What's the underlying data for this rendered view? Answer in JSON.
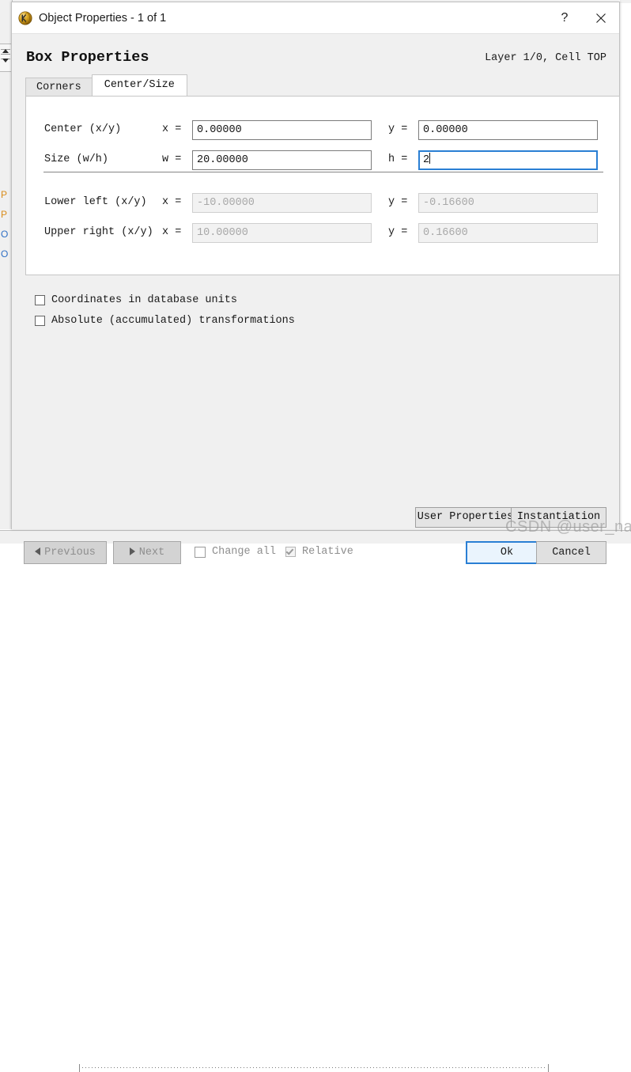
{
  "window": {
    "title": "Object Properties - 1 of 1",
    "icon": "klayout-sphere-icon",
    "help_label": "?",
    "close_label": "✕"
  },
  "dialog": {
    "heading": "Box Properties",
    "layer_info": "Layer 1/0, Cell TOP",
    "tabs": [
      {
        "label": "Corners",
        "active": false
      },
      {
        "label": "Center/Size",
        "active": true
      }
    ],
    "fields": [
      {
        "label": "Center (x/y)",
        "x_eq": "x =",
        "x_value": "0.00000",
        "y_eq": "y =",
        "y_value": "0.00000",
        "readonly": false,
        "focused": false
      },
      {
        "label": "Size (w/h)",
        "x_eq": "w =",
        "x_value": "20.00000",
        "y_eq": "h =",
        "y_value": "2",
        "readonly": false,
        "focused": true
      },
      {
        "label": "Lower left (x/y)",
        "x_eq": "x =",
        "x_value": "-10.00000",
        "y_eq": "y =",
        "y_value": "-0.16600",
        "readonly": true,
        "focused": false
      },
      {
        "label": "Upper right (x/y)",
        "x_eq": "x =",
        "x_value": "10.00000",
        "y_eq": "y =",
        "y_value": "0.16600",
        "readonly": true,
        "focused": false
      }
    ],
    "options": [
      {
        "label": "Coordinates in database units",
        "checked": false,
        "disabled": false
      },
      {
        "label": "Absolute (accumulated) transformations",
        "checked": false,
        "disabled": false
      }
    ],
    "secondary_buttons": {
      "user_properties": "User Properties",
      "instantiation": "Instantiation"
    },
    "footer": {
      "previous": "Previous",
      "next": "Next",
      "change_all": "Change all",
      "relative": "Relative",
      "ok": "Ok",
      "cancel": "Cancel"
    }
  },
  "background": {
    "tree_items": [
      "P",
      "P",
      "O",
      "O"
    ]
  },
  "watermark": "CSDN @user_na",
  "colors": {
    "accent": "#2a7fd4",
    "ok_fill": "#eaf4fd",
    "dialog_bg": "#f0f0f0",
    "panel_bg": "#ffffff",
    "readonly_text": "#a8a8a8",
    "disabled_text": "#8e8e8e"
  }
}
